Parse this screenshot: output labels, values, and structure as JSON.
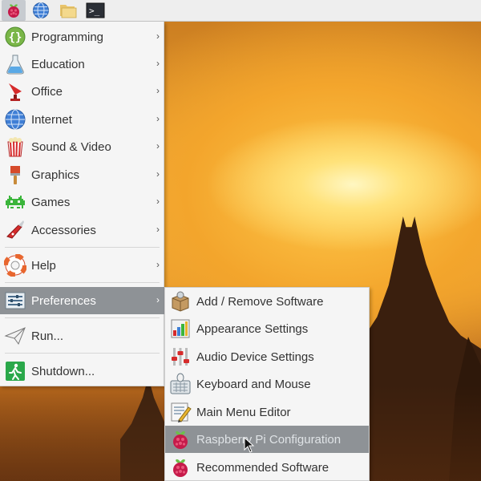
{
  "taskbar": {
    "buttons": [
      {
        "icon": "raspberry-menu-icon"
      },
      {
        "icon": "globe-browser-icon"
      },
      {
        "icon": "folder-icon"
      },
      {
        "icon": "terminal-icon",
        "label": ">_"
      }
    ]
  },
  "menu": {
    "items": [
      {
        "label": "Programming",
        "icon": "programming-icon",
        "has_submenu": true
      },
      {
        "label": "Education",
        "icon": "education-icon",
        "has_submenu": true
      },
      {
        "label": "Office",
        "icon": "office-icon",
        "has_submenu": true
      },
      {
        "label": "Internet",
        "icon": "internet-globe-icon",
        "has_submenu": true
      },
      {
        "label": "Sound & Video",
        "icon": "sound-video-icon",
        "has_submenu": true
      },
      {
        "label": "Graphics",
        "icon": "graphics-brush-icon",
        "has_submenu": true
      },
      {
        "label": "Games",
        "icon": "games-invader-icon",
        "has_submenu": true
      },
      {
        "label": "Accessories",
        "icon": "accessories-knife-icon",
        "has_submenu": true
      },
      {
        "label": "Help",
        "icon": "help-lifebuoy-icon",
        "has_submenu": true
      },
      {
        "label": "Preferences",
        "icon": "preferences-icon",
        "has_submenu": true,
        "selected": true
      },
      {
        "label": "Run...",
        "icon": "run-paperplane-icon",
        "has_submenu": false
      },
      {
        "label": "Shutdown...",
        "icon": "shutdown-exit-icon",
        "has_submenu": false
      }
    ],
    "arrow": "›"
  },
  "submenu": {
    "items": [
      {
        "label": "Add / Remove Software",
        "icon": "add-remove-software-icon"
      },
      {
        "label": "Appearance Settings",
        "icon": "appearance-settings-icon"
      },
      {
        "label": "Audio Device Settings",
        "icon": "audio-device-icon"
      },
      {
        "label": "Keyboard and Mouse",
        "icon": "keyboard-mouse-icon"
      },
      {
        "label": "Main Menu Editor",
        "icon": "menu-editor-icon"
      },
      {
        "label": "Raspberry Pi Configuration",
        "icon": "raspberry-config-icon",
        "hover": true
      },
      {
        "label": "Recommended Software",
        "icon": "raspberry-recommended-icon"
      }
    ]
  },
  "colors": {
    "selected_bg": "#8e9296",
    "menu_bg": "#f5f5f5",
    "raspberry_red": "#c51a4a",
    "raspberry_green": "#6cc04a"
  }
}
